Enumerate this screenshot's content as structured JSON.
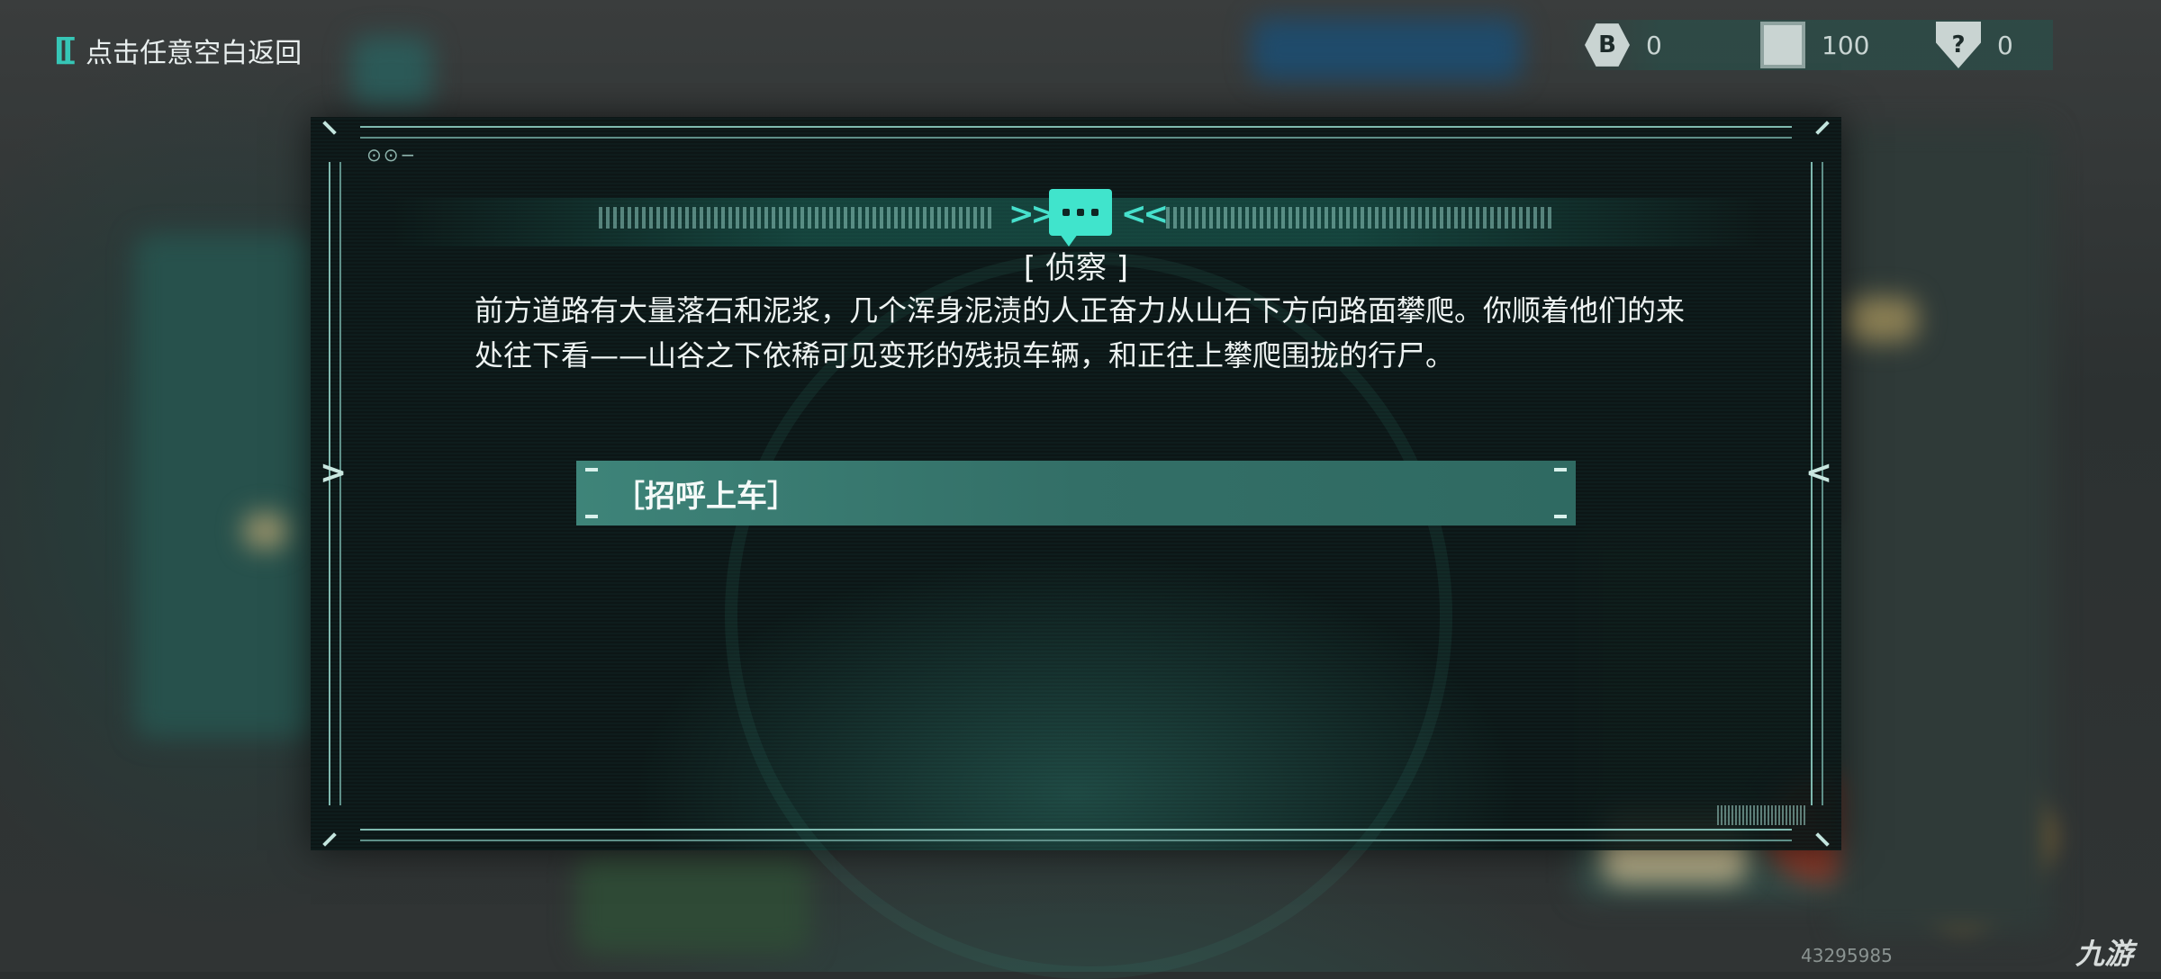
{
  "top_bar": {
    "back_label": "点击任意空白返回",
    "back_icon": "double-bracket-icon"
  },
  "resources": [
    {
      "icon": "coin-hex-icon",
      "value": "0"
    },
    {
      "icon": "chip-icon",
      "value": "100"
    },
    {
      "icon": "question-card-icon",
      "value": "0"
    }
  ],
  "dialog": {
    "title": "[ 侦察 ]",
    "body": "前方道路有大量落石和泥浆，几个浑身泥渍的人正奋力从山石下方向路面攀爬。你顺着他们的来处往下看——山谷之下依稀可见变形的残损车辆，和正往上攀爬围拢的行尸。",
    "options": [
      {
        "label": "［招呼上车］"
      }
    ]
  },
  "watermark": {
    "number": "43295985",
    "logo": "九游"
  },
  "colors": {
    "accent": "#40e4cc",
    "option_bg": "#3e8479",
    "text": "#eef3f2"
  }
}
